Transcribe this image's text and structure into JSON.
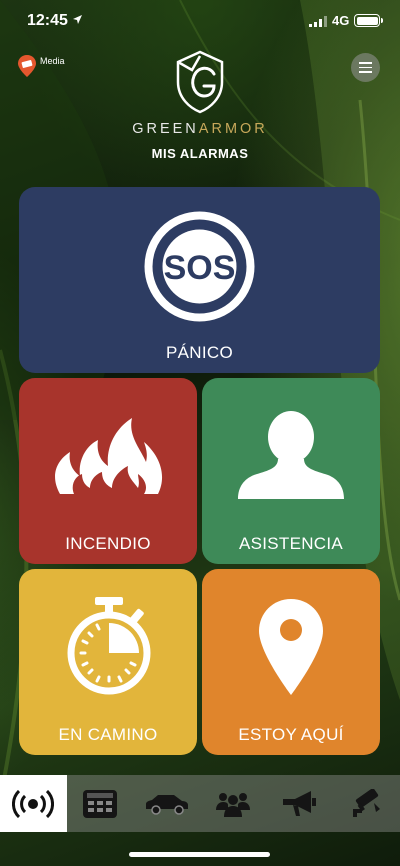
{
  "status": {
    "time": "12:45",
    "network": "4G"
  },
  "header": {
    "media_label": "Media",
    "brand_primary": "GREEN",
    "brand_accent": "ARMOR",
    "subtitle": "MIS ALARMAS"
  },
  "tiles": [
    {
      "label": "PÁNICO",
      "icon": "sos-icon",
      "color": "#2d3c62"
    },
    {
      "label": "INCENDIO",
      "icon": "fire-icon",
      "color": "#a8342c"
    },
    {
      "label": "ASISTENCIA",
      "icon": "person-icon",
      "color": "#3e8a58"
    },
    {
      "label": "EN CAMINO",
      "icon": "stopwatch-icon",
      "color": "#e2b53b"
    },
    {
      "label": "ESTOY AQUÍ",
      "icon": "location-pin-icon",
      "color": "#e0852c"
    }
  ],
  "sos_text": "SOS",
  "tabbar": [
    {
      "icon": "broadcast-icon",
      "active": true
    },
    {
      "icon": "keypad-icon",
      "active": false
    },
    {
      "icon": "car-icon",
      "active": false
    },
    {
      "icon": "group-icon",
      "active": false
    },
    {
      "icon": "megaphone-icon",
      "active": false
    },
    {
      "icon": "camera-icon",
      "active": false
    }
  ]
}
